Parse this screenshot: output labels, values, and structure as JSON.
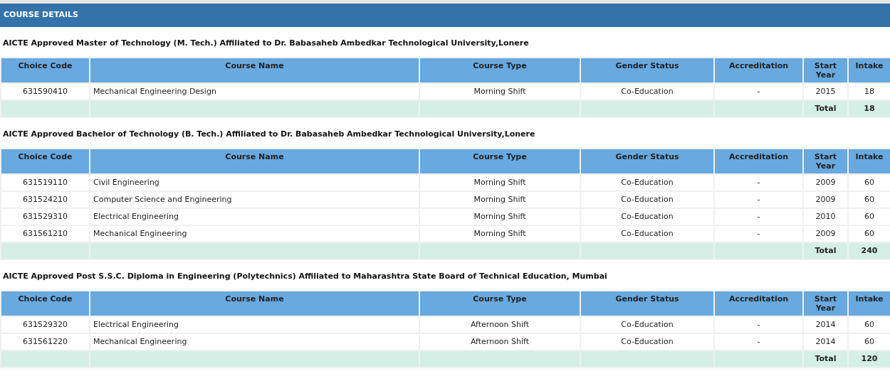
{
  "header": {
    "title": "COURSE DETAILS"
  },
  "sections": [
    {
      "title": "AICTE Approved Master of Technology (M. Tech.) Affiliated to Dr. Babasaheb Ambedkar Technological University,Lonere",
      "columns": [
        "Choice Code",
        "Course Name",
        "Course Type",
        "Gender Status",
        "Accreditation",
        "Start Year",
        "Intake"
      ],
      "rows": [
        [
          "631590410",
          "Mechanical Engineering Design",
          "Morning Shift",
          "Co-Education",
          "-",
          "2015",
          "18"
        ]
      ],
      "total": {
        "label": "Total",
        "value": "18"
      }
    },
    {
      "title": "AICTE Approved Bachelor of Technology (B. Tech.) Affiliated to Dr. Babasaheb Ambedkar Technological University,Lonere",
      "columns": [
        "Choice Code",
        "Course Name",
        "Course Type",
        "Gender Status",
        "Accreditation",
        "Start Year",
        "Intake"
      ],
      "rows": [
        [
          "631519110",
          "Civil Engineering",
          "Morning Shift",
          "Co-Education",
          "-",
          "2009",
          "60"
        ],
        [
          "631524210",
          "Computer Science and Engineering",
          "Morning Shift",
          "Co-Education",
          "-",
          "2009",
          "60"
        ],
        [
          "631529310",
          "Electrical Engineering",
          "Morning Shift",
          "Co-Education",
          "-",
          "2010",
          "60"
        ],
        [
          "631561210",
          "Mechanical Engineering",
          "Morning Shift",
          "Co-Education",
          "-",
          "2009",
          "60"
        ]
      ],
      "total": {
        "label": "Total",
        "value": "240"
      }
    },
    {
      "title": "AICTE Approved Post S.S.C. Diploma in Engineering (Polytechnics) Affiliated to Maharashtra State Board of Technical Education, Mumbai",
      "columns": [
        "Choice Code",
        "Course Name",
        "Course Type",
        "Gender Status",
        "Accreditation",
        "Start Year",
        "Intake"
      ],
      "rows": [
        [
          "631529320",
          "Electrical Engineering",
          "Afternoon Shift",
          "Co-Education",
          "-",
          "2014",
          "60"
        ],
        [
          "631561220",
          "Mechanical Engineering",
          "Afternoon Shift",
          "Co-Education",
          "-",
          "2014",
          "60"
        ]
      ],
      "total": {
        "label": "Total",
        "value": "120"
      }
    }
  ]
}
